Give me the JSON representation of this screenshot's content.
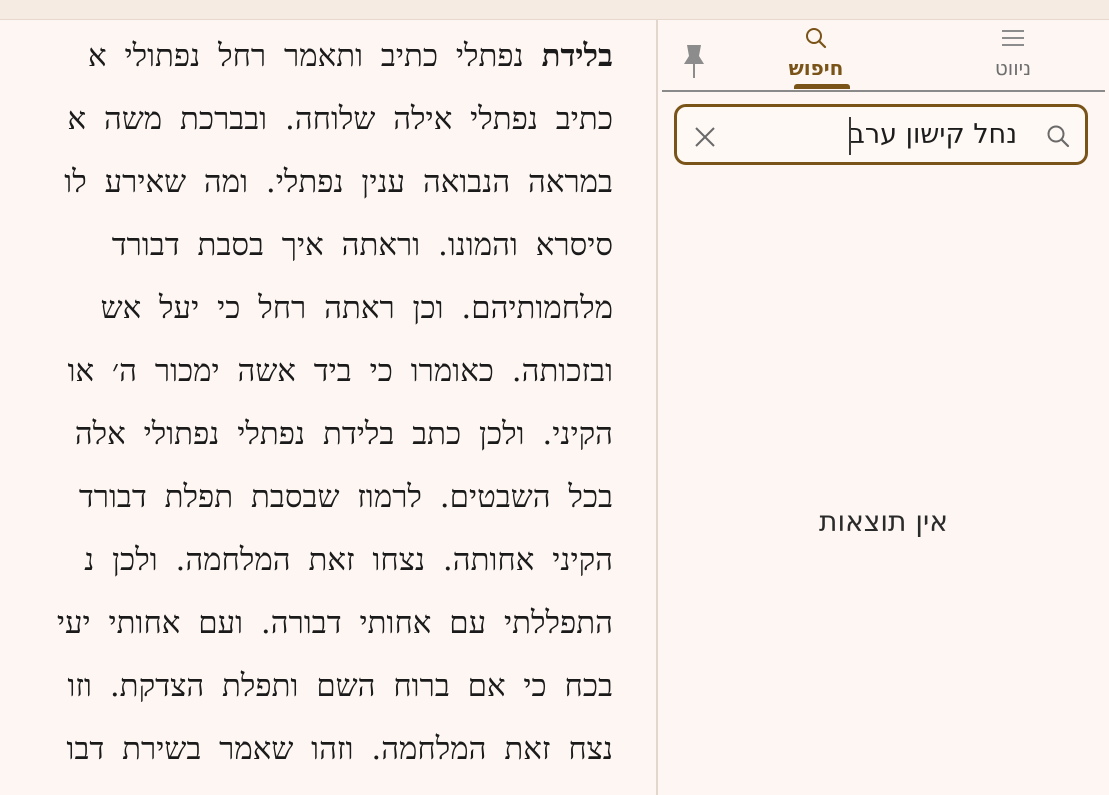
{
  "reader": {
    "lines": [
      {
        "bold": "בלידת",
        "text": " נפתלי כתיב ותאמר רחל נפתולי א"
      },
      {
        "bold": "",
        "text": "כתיב נפתלי אילה שלוחה. ובברכת משה א"
      },
      {
        "bold": "",
        "text": "במראה הנבואה ענין נפתלי. ומה שאירע לו"
      },
      {
        "bold": "",
        "text": "סיסרא והמונו. וראתה איך בסבת דבורד"
      },
      {
        "bold": "",
        "text": "מלחמותיהם. וכן ראתה רחל כי יעל אש"
      },
      {
        "bold": "",
        "text": "ובזכותה. כאומרו כי ביד אשה ימכור ה׳ או"
      },
      {
        "bold": "",
        "text": "הקיני. ולכן כתב בלידת נפתלי נפתולי אלה"
      },
      {
        "bold": "",
        "text": "בכל השבטים. לרמוז שבסבת תפלת דבורד"
      },
      {
        "bold": "",
        "text": "הקיני אחותה. נצחו זאת המלחמה. ולכן נ"
      },
      {
        "bold": "",
        "text": "התפללתי עם אחותי דבורה. ועם אחותי יעי"
      },
      {
        "bold": "",
        "text": "בכח כי אם ברוח השם ותפלת הצדקת. וזו"
      },
      {
        "bold": "",
        "text": "נצח זאת המלחמה. וזהו שאמר בשירת דבו"
      }
    ]
  },
  "panel": {
    "tabs": [
      {
        "id": "nav",
        "label": "ניווט",
        "icon": "menu-icon",
        "active": false
      },
      {
        "id": "search",
        "label": "חיפוש",
        "icon": "search-icon",
        "active": true
      }
    ],
    "search": {
      "value": "נחל קישון ערב",
      "placeholder": ""
    },
    "results_message": "אין תוצאות"
  },
  "colors": {
    "accent": "#7a5318",
    "background": "#fdf6f3",
    "topbar": "#f6ebe3"
  }
}
